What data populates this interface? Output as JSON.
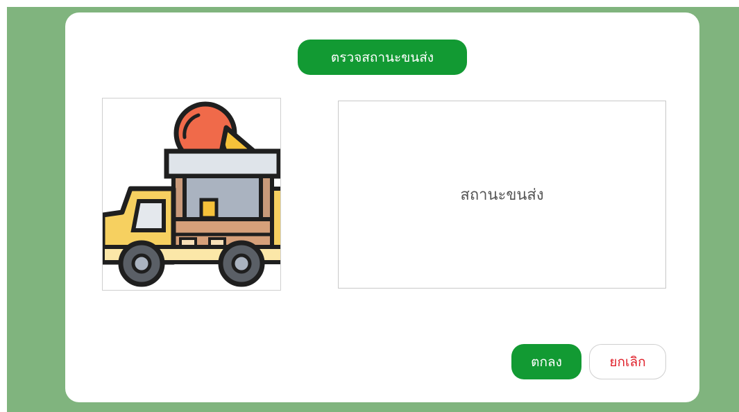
{
  "dialog": {
    "title": "ตรวจสถานะขนส่ง",
    "image_icon": "food-truck-icon",
    "status_text": "สถานะขนส่ง",
    "ok_label": "ตกลง",
    "cancel_label": "ยกเลิก"
  },
  "colors": {
    "backdrop": "#80b47e",
    "primary_green": "#129a33",
    "cancel_red": "#e0202a"
  }
}
